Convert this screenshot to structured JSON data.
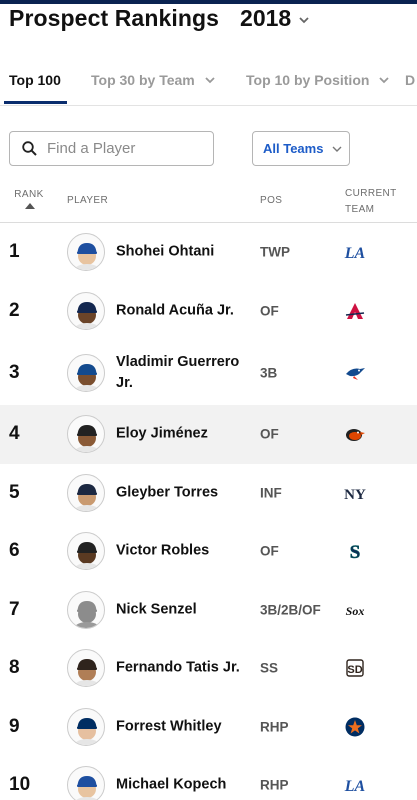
{
  "header": {
    "title": "Prospect Rankings",
    "year": "2018"
  },
  "tabs": [
    {
      "label": "Top 100",
      "active": true
    },
    {
      "label": "Top 30 by Team",
      "active": false
    },
    {
      "label": "Top 10 by Position",
      "active": false
    },
    {
      "label": "D",
      "active": false
    }
  ],
  "filters": {
    "search_placeholder": "Find a Player",
    "team_select": "All Teams"
  },
  "columns": {
    "rank": "RANK",
    "player": "PLAYER",
    "pos": "POS",
    "team_line1": "CURRENT",
    "team_line2": "TEAM"
  },
  "colors": {
    "accent": "#1d5cc8",
    "navy": "#0a2351",
    "row_highlight": "#f2f2f2"
  },
  "players": [
    {
      "rank": "1",
      "name": "Shohei Ohtani",
      "pos": "TWP",
      "team_icon": "dodgers-logo-icon",
      "cap": "#1e4fa0",
      "skin": "#e8c4a0"
    },
    {
      "rank": "2",
      "name": "Ronald Acuña Jr.",
      "pos": "OF",
      "team_icon": "braves-logo-icon",
      "cap": "#13274f",
      "skin": "#6b4428"
    },
    {
      "rank": "3",
      "name": "Vladimir Guerrero Jr.",
      "pos": "3B",
      "team_icon": "blue-jays-logo-icon",
      "cap": "#134a8e",
      "skin": "#7a4e2e"
    },
    {
      "rank": "4",
      "name": "Eloy Jiménez",
      "pos": "OF",
      "team_icon": "orioles-logo-icon",
      "cap": "#222222",
      "skin": "#8a5a36"
    },
    {
      "rank": "5",
      "name": "Gleyber Torres",
      "pos": "INF",
      "team_icon": "yankees-logo-icon",
      "cap": "#1c2841",
      "skin": "#c99a70"
    },
    {
      "rank": "6",
      "name": "Victor Robles",
      "pos": "OF",
      "team_icon": "mariners-logo-icon",
      "cap": "#222222",
      "skin": "#5a3a22"
    },
    {
      "rank": "7",
      "name": "Nick Senzel",
      "pos": "3B/2B/OF",
      "team_icon": "white-sox-logo-icon",
      "cap": "#8c8c8c",
      "skin": "#8c8c8c"
    },
    {
      "rank": "8",
      "name": "Fernando Tatis Jr.",
      "pos": "SS",
      "team_icon": "padres-logo-icon",
      "cap": "#2f241d",
      "skin": "#b07e56"
    },
    {
      "rank": "9",
      "name": "Forrest Whitley",
      "pos": "RHP",
      "team_icon": "astros-logo-icon",
      "cap": "#002d62",
      "skin": "#e6c0a0"
    },
    {
      "rank": "10",
      "name": "Michael Kopech",
      "pos": "RHP",
      "team_icon": "dodgers-logo-icon",
      "cap": "#1e4fa0",
      "skin": "#e8c4a0"
    }
  ]
}
